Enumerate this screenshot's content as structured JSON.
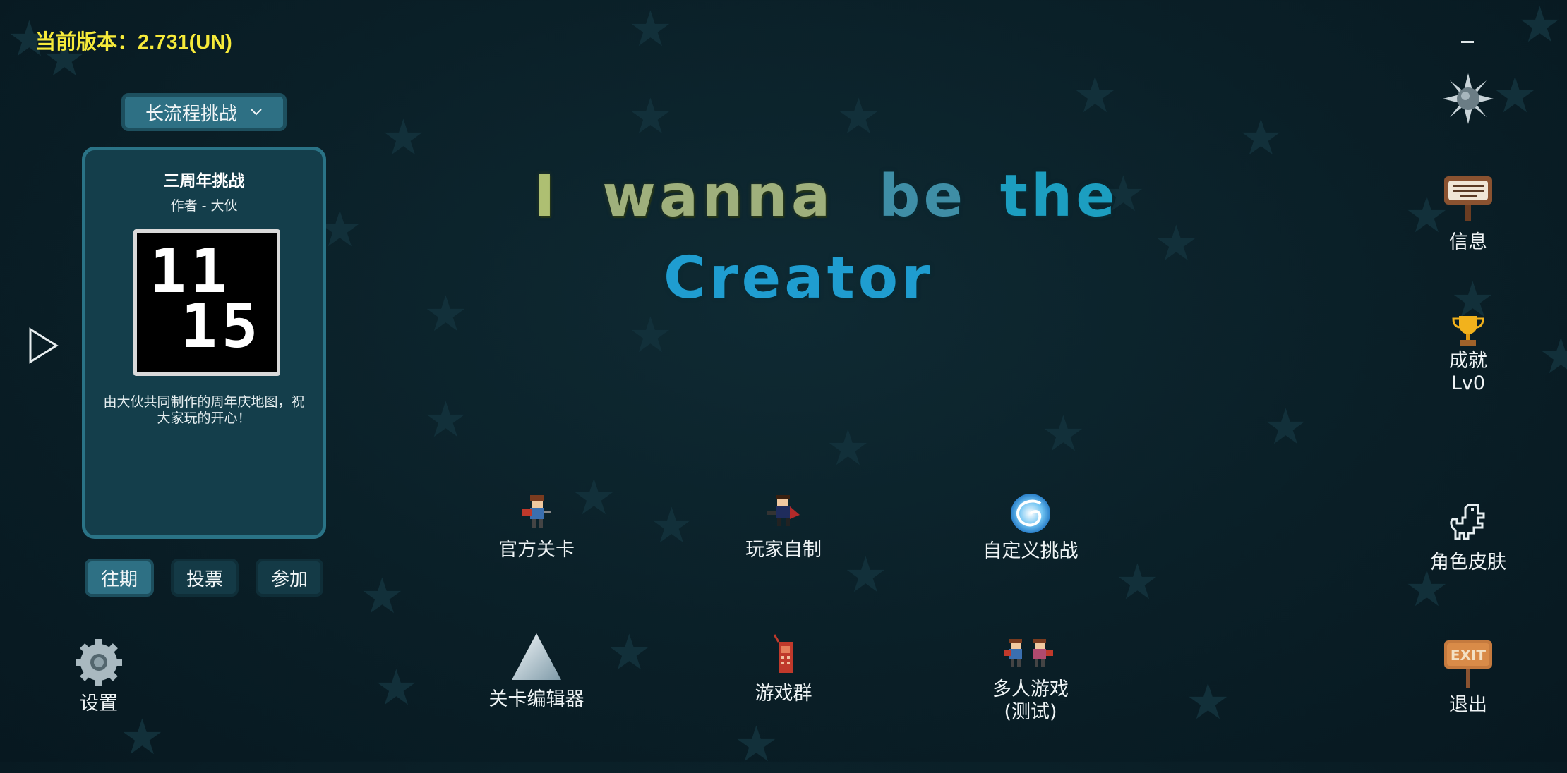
{
  "version_label": "当前版本：2.731(UN)",
  "mode_select": {
    "value": "长流程挑战"
  },
  "featured": {
    "title": "三周年挑战",
    "author": "作者 - 大伙",
    "thumb_line1": "11",
    "thumb_line2": "15",
    "description": "由大伙共同制作的周年庆地图，祝大家玩的开心！"
  },
  "tabs": [
    "往期",
    "投票",
    "参加"
  ],
  "title": {
    "line1_words": [
      "I",
      "wanna",
      "be",
      "the"
    ],
    "line2": "Creator"
  },
  "menu": {
    "official_levels": "官方关卡",
    "player_made": "玩家自制",
    "custom_challenge": "自定义挑战",
    "level_editor": "关卡编辑器",
    "game_group": "游戏群",
    "multiplayer_1": "多人游戏",
    "multiplayer_2": "(测试)"
  },
  "side": {
    "settings": "设置",
    "info": "信息",
    "achievement": "成就",
    "achievement_level": "Lv0",
    "skins": "角色皮肤",
    "exit": "退出",
    "exit_sign": "EXIT"
  },
  "icons": {
    "settings": "gear-icon",
    "spike_ball": "spike-ball-icon",
    "info": "signboard-icon",
    "achievement": "trophy-icon",
    "skins": "dinosaur-icon",
    "exit": "exit-sign-icon",
    "play": "play-arrow-icon",
    "dropdown": "chevron-down-icon"
  }
}
